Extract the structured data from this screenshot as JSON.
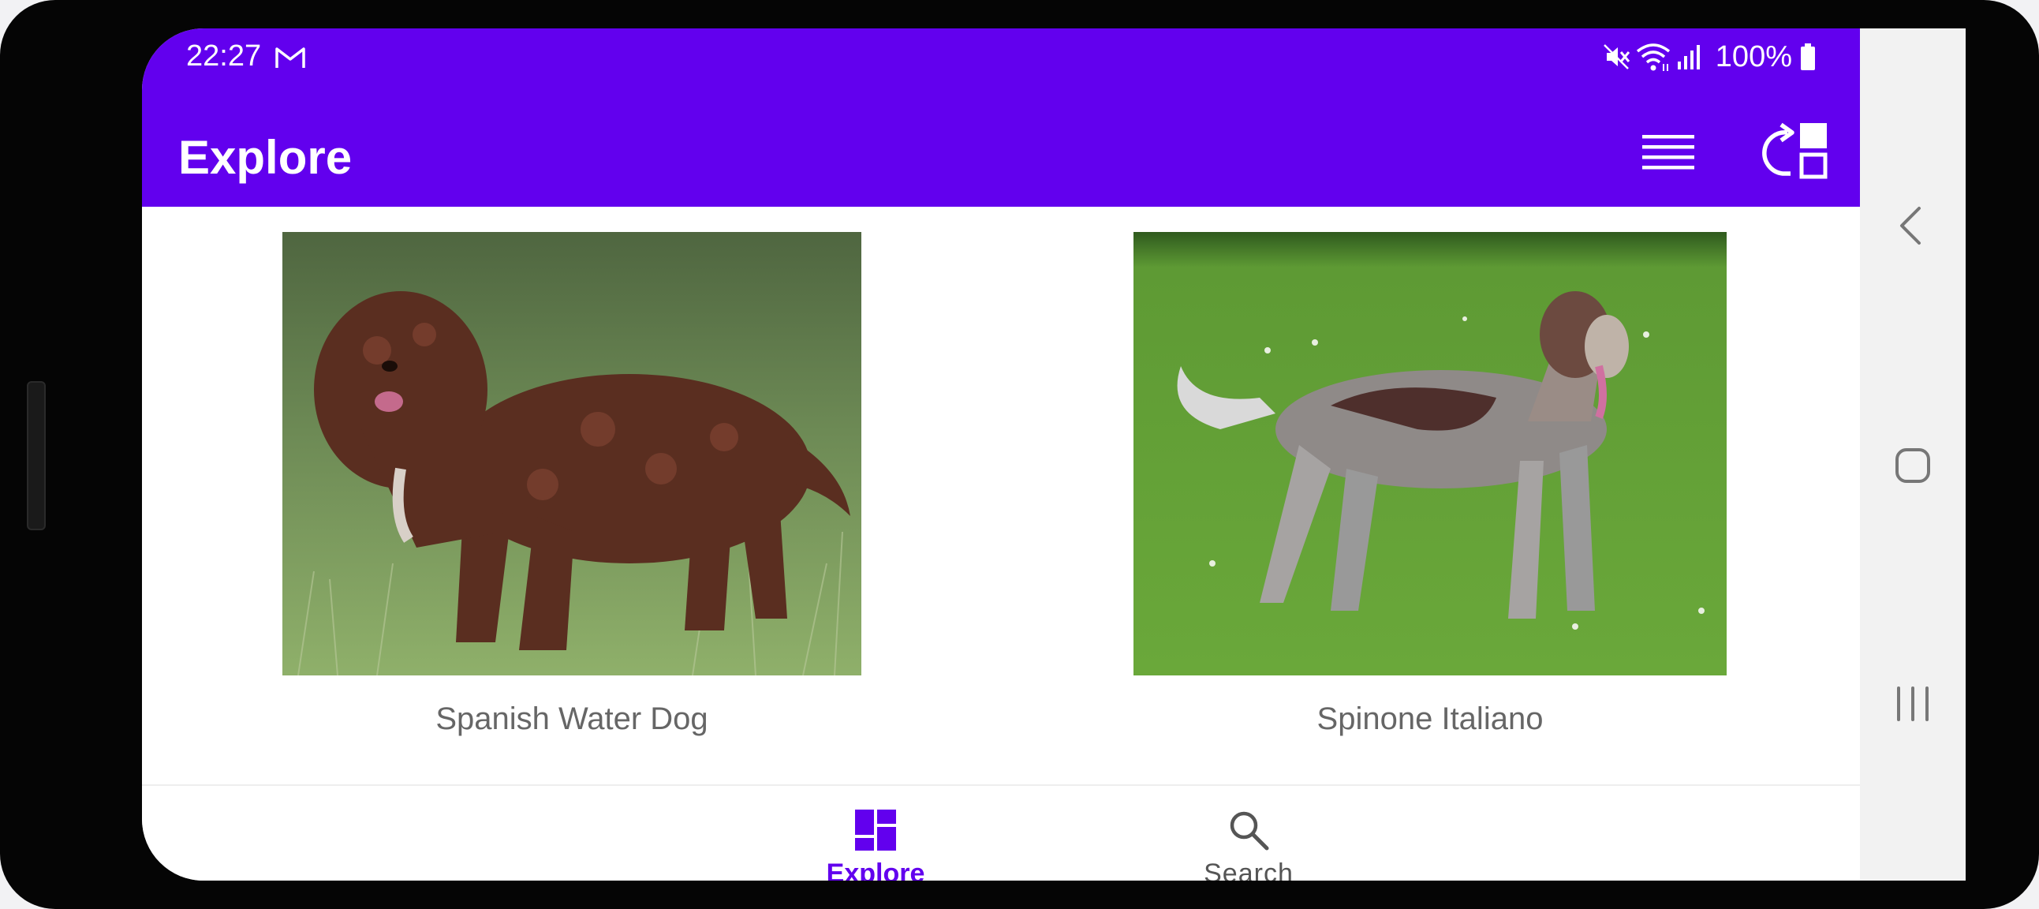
{
  "status_bar": {
    "time": "22:27",
    "notification_icon": "gmail-icon",
    "icons": [
      "mute-icon",
      "wifi-icon",
      "signal-icon",
      "battery-icon"
    ],
    "battery": "100%"
  },
  "app_bar": {
    "title": "Explore",
    "actions": [
      "list-view-icon",
      "rotate-layout-icon"
    ],
    "color": "#6200ee"
  },
  "grid": {
    "items": [
      {
        "label": "Spanish Water Dog"
      },
      {
        "label": "Spinone Italiano"
      }
    ]
  },
  "bottom_nav": {
    "items": [
      {
        "label": "Explore",
        "icon": "dashboard-icon",
        "selected": true
      },
      {
        "label": "Search",
        "icon": "search-icon",
        "selected": false
      }
    ]
  },
  "system_nav": [
    "back-icon",
    "home-icon",
    "recents-icon"
  ]
}
